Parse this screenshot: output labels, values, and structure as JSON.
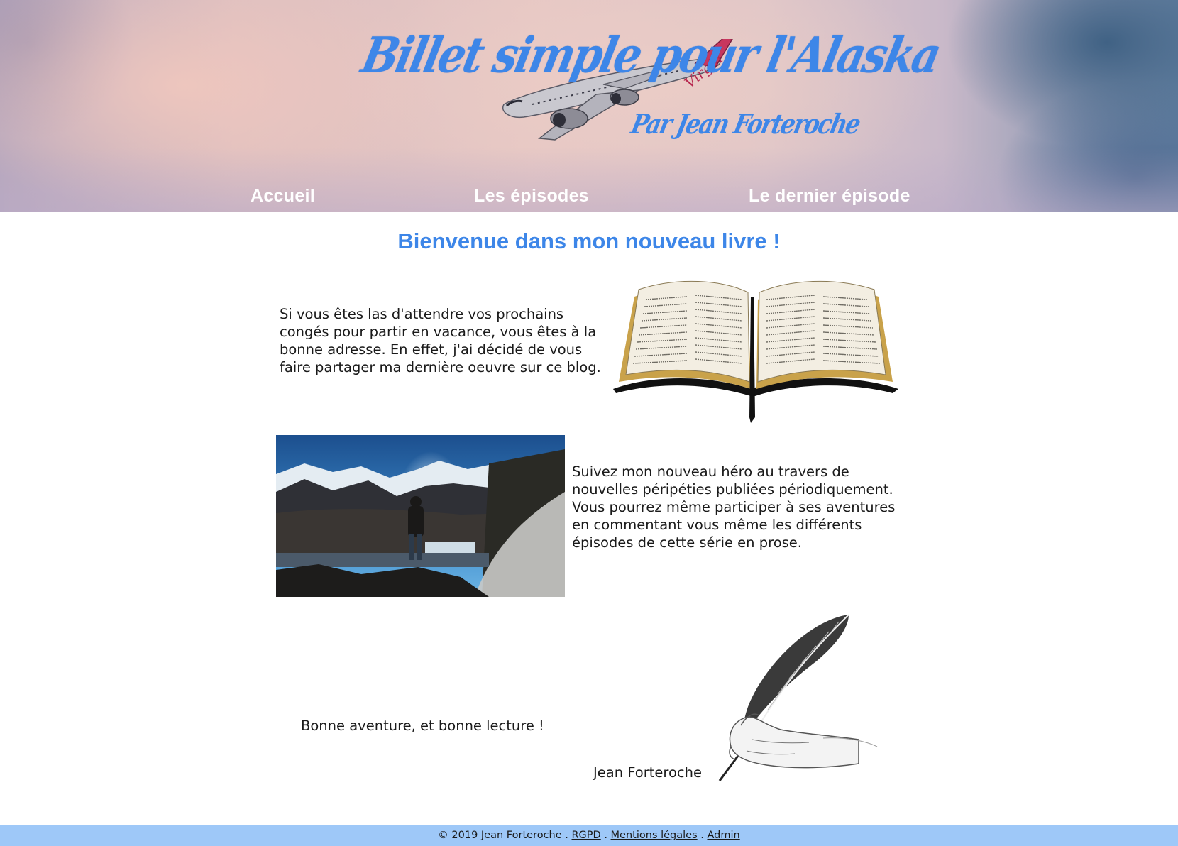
{
  "header": {
    "title": "Billet simple pour l'Alaska",
    "subtitle": "Par Jean Forteroche",
    "background_image": "sky-clouds-with-airplane",
    "title_color": "#3d86e8"
  },
  "nav": {
    "items": [
      {
        "label": "Accueil"
      },
      {
        "label": "Les épisodes"
      },
      {
        "label": "Le dernier épisode"
      }
    ]
  },
  "main": {
    "heading": "Bienvenue dans mon nouveau livre !",
    "intro": "Si vous êtes las d'attendre vos prochains congés pour partir en vacance, vous êtes à la bonne adresse. En effet, j'ai décidé de vous faire partager ma dernière oeuvre sur ce blog.",
    "hero_line1": "Suivez mon nouveau héro au travers de nouvelles péripéties publiées périodiquement.",
    "hero_line2": "Vous pourrez même participer à ses aventures en commentant vous même les différents épisodes de cette série en prose.",
    "closing": "Bonne aventure, et bonne lecture !",
    "signature": "Jean Forteroche",
    "images": {
      "book": "open-book-image",
      "landscape": "mountain-landscape-image",
      "quill": "hand-with-quill-image"
    }
  },
  "footer": {
    "copyright": "© 2019 Jean Forteroche",
    "sep": " . ",
    "links": [
      {
        "label": "RGPD"
      },
      {
        "label": "Mentions légales"
      },
      {
        "label": "Admin"
      }
    ],
    "background": "#9ec8f8"
  }
}
